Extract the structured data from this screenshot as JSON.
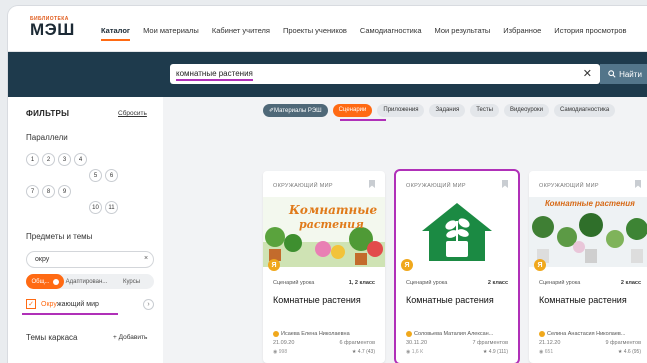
{
  "logo": {
    "top": "БИБЛИОТЕКА",
    "main": "МЭШ"
  },
  "nav": [
    {
      "label": "Каталог"
    },
    {
      "label": "Мои материалы"
    },
    {
      "label": "Кабинет учителя"
    },
    {
      "label": "Проекты учеников"
    },
    {
      "label": "Самодиагностика"
    },
    {
      "label": "Мои результаты"
    },
    {
      "label": "Избранное"
    },
    {
      "label": "История просмотров"
    }
  ],
  "search": {
    "value": "комнатные растения",
    "clear": "✕",
    "button_label": "Найти"
  },
  "sidebar": {
    "title": "ФИЛЬТРЫ",
    "reset": "Сбросить",
    "parallels_title": "Параллели",
    "grades": [
      "1",
      "2",
      "3",
      "4",
      "5",
      "6",
      "7",
      "8",
      "9",
      "10",
      "11"
    ],
    "subjects_title": "Предметы и темы",
    "subject_input": "окру",
    "subject_clear": "×",
    "segments": [
      "Общ...",
      "Адаптирован...",
      "Курсы"
    ],
    "checked_subject_match": "Окру",
    "checked_subject_rest": "жающий мир",
    "frames_title": "Темы каркаса",
    "add_link": "+ Добавить"
  },
  "chips": [
    {
      "label": "Материалы РЭШ"
    },
    {
      "label": "Сценарии"
    },
    {
      "label": "Приложения"
    },
    {
      "label": "Задания"
    },
    {
      "label": "Тесты"
    },
    {
      "label": "Видеоуроки"
    },
    {
      "label": "Самодиагностика"
    }
  ],
  "cards": [
    {
      "subject": "ОКРУЖАЮЩИЙ МИР",
      "image_text_1": "Комнатные",
      "image_text_2": "растения",
      "badge": "Я",
      "type": "Сценарий урока",
      "grade": "1, 2 класс",
      "title": "Комнатные растения",
      "author": "Исаева Елена Николаевна",
      "date": "21.09.20",
      "fragments": "6 фрагментов",
      "views": "998",
      "rating": "4.7 (43)"
    },
    {
      "subject": "ОКРУЖАЮЩИЙ МИР",
      "badge": "Я",
      "type": "Сценарий урока",
      "grade": "2 класс",
      "title": "Комнатные растения",
      "author": "Соловьева Маталия Алексан...",
      "date": "30.11.20",
      "fragments": "7 фрагментов",
      "views": "1,6 К",
      "rating": "4.9 (111)",
      "icon_color": "#1b8a43"
    },
    {
      "subject": "ОКРУЖАЮЩИЙ МИР",
      "image_text_1": "Комнатные растения",
      "badge": "Я",
      "type": "Сценарий урока",
      "grade": "2 класс",
      "title": "Комнатные растения",
      "author": "Селина Анастасия Николаев...",
      "date": "21.12.20",
      "fragments": "9 фрагментов",
      "views": "651",
      "rating": "4.6 (95)"
    }
  ],
  "colors": {
    "accent": "#ff6a13",
    "band": "#1e3a4c",
    "highlight": "#b030b8"
  }
}
